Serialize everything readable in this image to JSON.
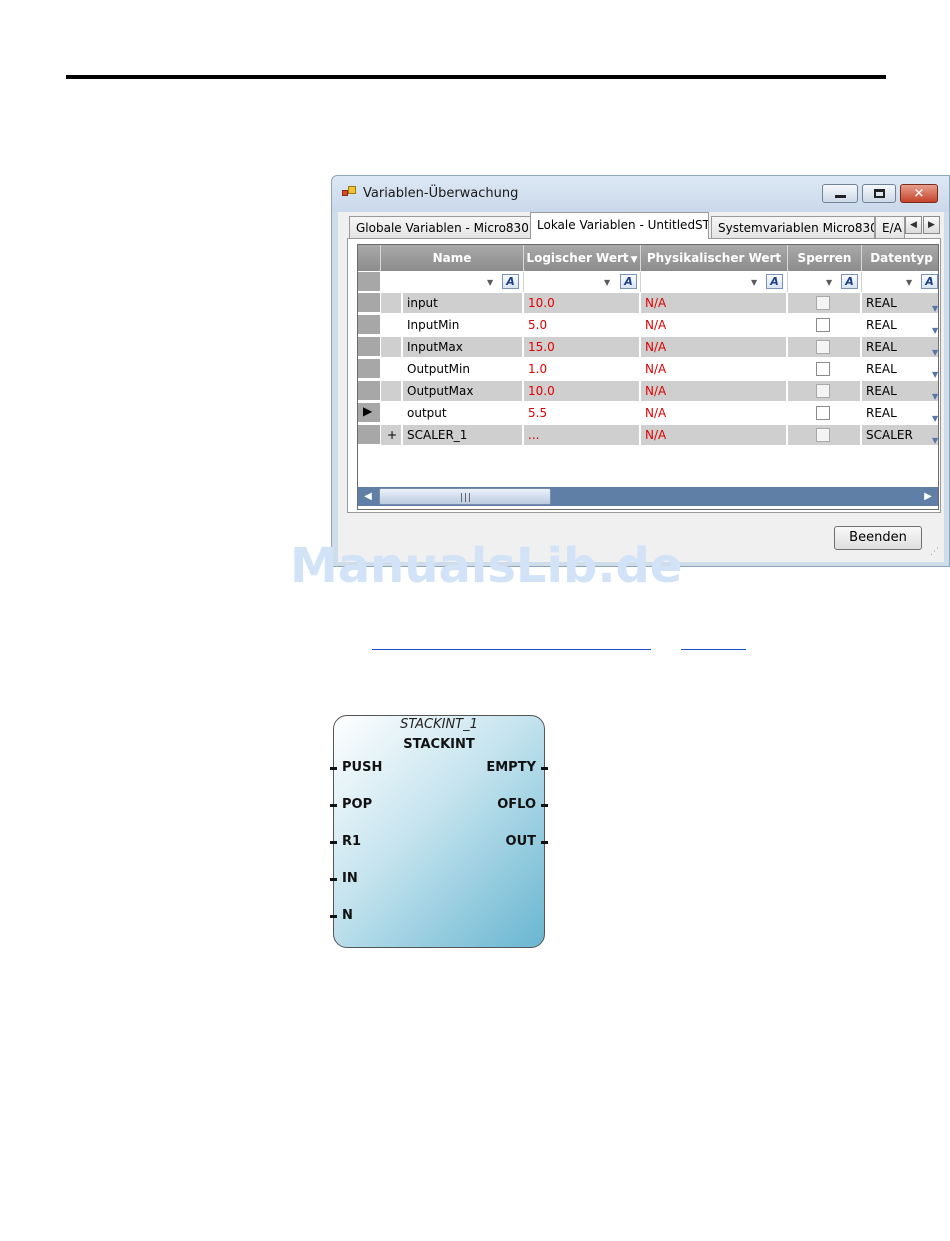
{
  "window": {
    "title": "Variablen-Überwachung",
    "tabs": [
      {
        "label": "Globale Variablen - Micro830",
        "active": false
      },
      {
        "label": "Lokale Variablen - UntitledST",
        "active": true
      },
      {
        "label": "Systemvariablen Micro830",
        "active": false
      },
      {
        "label": "E/A",
        "active": false
      }
    ],
    "columns": [
      "Name",
      "Logischer Wert",
      "Physikalischer Wert",
      "Sperren",
      "Datentyp"
    ],
    "rows": [
      {
        "name": "input",
        "logical": "10.0",
        "physical": "N/A",
        "type": "REAL"
      },
      {
        "name": "InputMin",
        "logical": "5.0",
        "physical": "N/A",
        "type": "REAL"
      },
      {
        "name": "InputMax",
        "logical": "15.0",
        "physical": "N/A",
        "type": "REAL"
      },
      {
        "name": "OutputMin",
        "logical": "1.0",
        "physical": "N/A",
        "type": "REAL"
      },
      {
        "name": "OutputMax",
        "logical": "10.0",
        "physical": "N/A",
        "type": "REAL"
      },
      {
        "name": "output",
        "logical": "5.5",
        "physical": "N/A",
        "type": "REAL"
      },
      {
        "name": "SCALER_1",
        "logical": "...",
        "physical": "N/A",
        "type": "SCALER"
      }
    ],
    "expand_symbol": "+",
    "current_row_marker": "▶",
    "filter_button_glyph": "A",
    "end_button": "Beenden",
    "colors": {
      "value_text": "#e00000",
      "scroll_track": "#5f7fa7",
      "header": "#9a9a9a"
    }
  },
  "watermark": "ManualsLib.de",
  "function_block": {
    "instance": "STACKINT_1",
    "type": "STACKINT",
    "inputs": [
      "PUSH",
      "POP",
      "R1",
      "IN",
      "N"
    ],
    "outputs": [
      "EMPTY",
      "OFLO",
      "OUT"
    ]
  }
}
